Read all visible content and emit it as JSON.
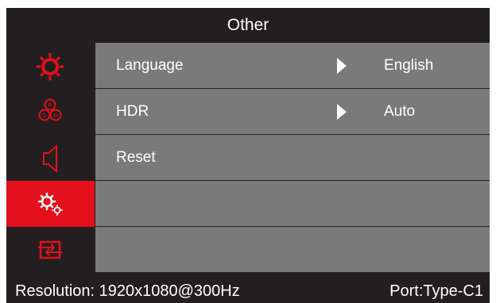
{
  "header": {
    "title": "Other"
  },
  "sidebar": {
    "items": [
      {
        "icon": "brightness-icon",
        "active": false
      },
      {
        "icon": "color-rgb-icon",
        "active": false
      },
      {
        "icon": "speaker-icon",
        "active": false
      },
      {
        "icon": "settings-gears-icon",
        "active": true
      },
      {
        "icon": "input-source-icon",
        "active": false
      }
    ]
  },
  "menu": {
    "rows": [
      {
        "label": "Language",
        "value": "English",
        "has_arrow": true
      },
      {
        "label": "HDR",
        "value": "Auto",
        "has_arrow": true
      },
      {
        "label": "Reset",
        "value": "",
        "has_arrow": false
      },
      {
        "label": "",
        "value": "",
        "has_arrow": false
      },
      {
        "label": "",
        "value": "",
        "has_arrow": false
      }
    ]
  },
  "footer": {
    "resolution": "Resolution: 1920x1080@300Hz",
    "port": "Port:Type-C1"
  },
  "colors": {
    "background": "#231f20",
    "accent": "#e4101b",
    "row": "#7a7a7a",
    "text": "#ffffff"
  }
}
